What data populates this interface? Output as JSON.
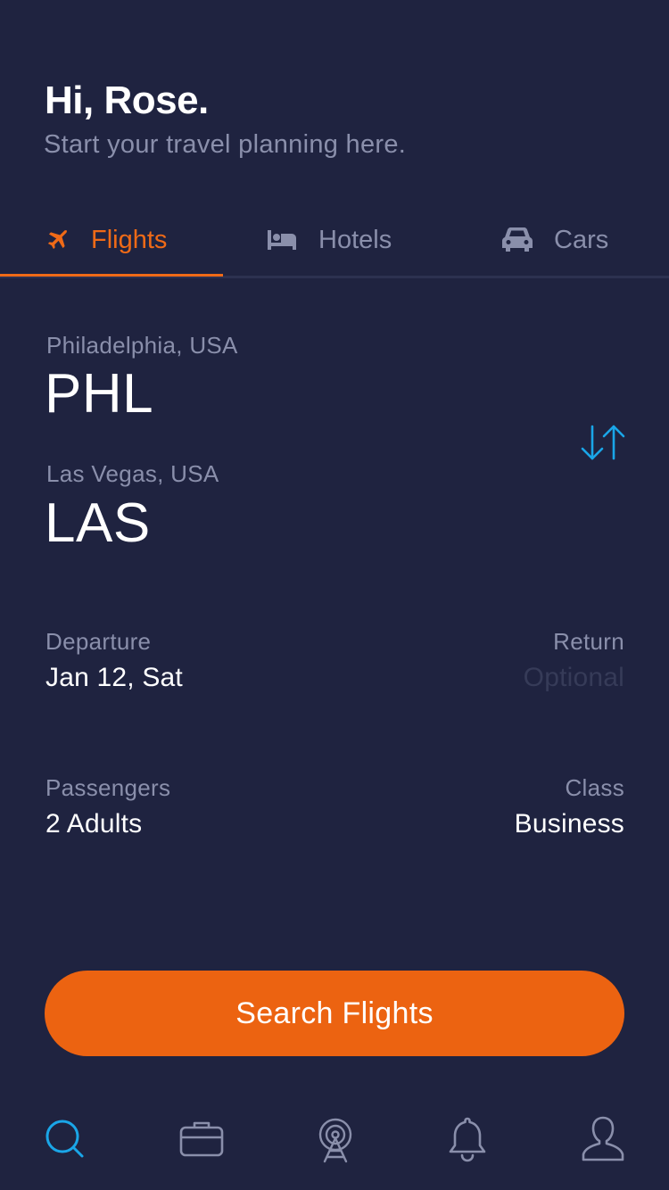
{
  "header": {
    "greeting": "Hi, Rose.",
    "subtitle": "Start your travel planning here."
  },
  "tabs": [
    {
      "label": "Flights",
      "icon": "plane-icon",
      "active": true
    },
    {
      "label": "Hotels",
      "icon": "bed-icon",
      "active": false
    },
    {
      "label": "Cars",
      "icon": "car-icon",
      "active": false
    }
  ],
  "route": {
    "from_city": "Philadelphia, USA",
    "from_code": "PHL",
    "to_city": "Las Vegas, USA",
    "to_code": "LAS",
    "swap_icon": "swap-arrows-icon"
  },
  "dates": {
    "departure_label": "Departure",
    "departure_value": "Jan 12, Sat",
    "return_label": "Return",
    "return_placeholder": "Optional"
  },
  "travelers": {
    "passengers_label": "Passengers",
    "passengers_value": "2 Adults",
    "class_label": "Class",
    "class_value": "Business"
  },
  "search_button": {
    "label": "Search Flights"
  },
  "bottom_nav": [
    {
      "icon": "search-icon",
      "active": true
    },
    {
      "icon": "briefcase-icon",
      "active": false
    },
    {
      "icon": "radar-tower-icon",
      "active": false
    },
    {
      "icon": "bell-icon",
      "active": false
    },
    {
      "icon": "profile-icon",
      "active": false
    }
  ],
  "colors": {
    "background": "#1f2340",
    "accent": "#ef6a17",
    "muted_text": "#8a8fab",
    "swap_icon": "#1aa6e8",
    "nav_active": "#1aa6e8"
  }
}
